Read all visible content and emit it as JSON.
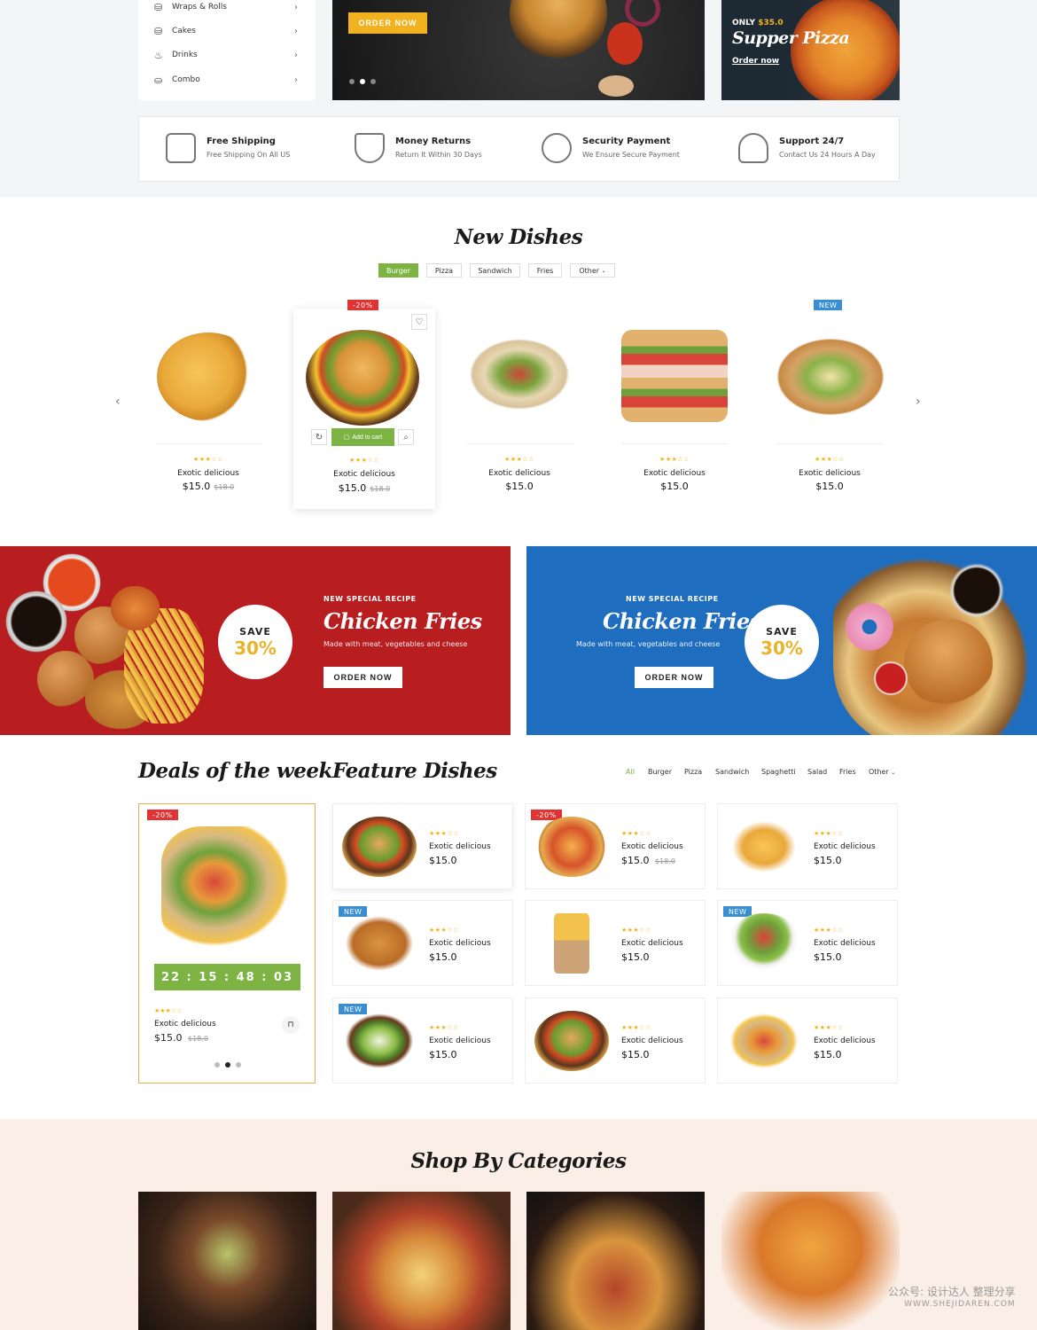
{
  "category_menu": [
    {
      "label": "Wraps & Rolls",
      "icon": "wrap-icon"
    },
    {
      "label": "Cakes",
      "icon": "cake-icon"
    },
    {
      "label": "Drinks",
      "icon": "drink-icon"
    },
    {
      "label": "Combo",
      "icon": "combo-icon"
    }
  ],
  "hero": {
    "order_label": "ORDER NOW"
  },
  "promo": {
    "only": "ONLY",
    "price": "$35.0",
    "title": "Supper Pizza",
    "link": "Order now"
  },
  "features": [
    {
      "title": "Free Shipping",
      "sub": "Free Shipping On All US",
      "icon": "scooter-icon"
    },
    {
      "title": "Money Returns",
      "sub": "Return It Within 30 Days",
      "icon": "shield-check-icon"
    },
    {
      "title": "Security Payment",
      "sub": "We Ensure Secure Payment",
      "icon": "hand-coin-icon"
    },
    {
      "title": "Support 24/7",
      "sub": "Contact Us 24 Hours A Day",
      "icon": "headset-icon"
    }
  ],
  "new_dishes": {
    "title": "New Dishes",
    "tabs": [
      "Burger",
      "Pizza",
      "Sandwich",
      "Fries",
      "Other"
    ],
    "products": [
      {
        "name": "Exotic delicious",
        "price": "$15.0",
        "old": "$18.0"
      },
      {
        "name": "Exotic delicious",
        "price": "$15.0",
        "old": "$18.0",
        "badge": "-20%",
        "cart": "Add to cart"
      },
      {
        "name": "Exotic delicious",
        "price": "$15.0"
      },
      {
        "name": "Exotic delicious",
        "price": "$15.0"
      },
      {
        "name": "Exotic delicious",
        "price": "$15.0",
        "badge": "NEW"
      }
    ]
  },
  "banners": [
    {
      "sub": "NEW SPECIAL RECIPE",
      "title": "Chicken Fries",
      "desc": "Made with meat, vegetables and cheese",
      "btn": "ORDER NOW",
      "save": "SAVE",
      "pct": "30%"
    },
    {
      "sub": "NEW SPECIAL RECIPE",
      "title": "Chicken Fries",
      "desc": "Made with meat, vegetables and cheese",
      "btn": "ORDER NOW",
      "save": "SAVE",
      "pct": "30%"
    }
  ],
  "deals": {
    "title": "Deals of the week",
    "badge": "-20%",
    "timer": "22 : 15 : 48 : 03",
    "name": "Exotic delicious",
    "price": "$15.0",
    "old": "$18.0"
  },
  "feature_dishes": {
    "title": "Feature Dishes",
    "filters": [
      "All",
      "Burger",
      "Pizza",
      "Sandwich",
      "Spaghetti",
      "Salad",
      "Fries",
      "Other"
    ],
    "items": [
      {
        "name": "Exotic delicious",
        "price": "$15.0"
      },
      {
        "name": "Exotic delicious",
        "price": "$15.0",
        "old": "$18.0",
        "badge": "-20%"
      },
      {
        "name": "Exotic delicious",
        "price": "$15.0"
      },
      {
        "name": "Exotic delicious",
        "price": "$15.0",
        "badge": "NEW"
      },
      {
        "name": "Exotic delicious",
        "price": "$15.0"
      },
      {
        "name": "Exotic delicious",
        "price": "$15.0",
        "badge": "NEW"
      },
      {
        "name": "Exotic delicious",
        "price": "$15.0",
        "badge": "NEW"
      },
      {
        "name": "Exotic delicious",
        "price": "$15.0"
      },
      {
        "name": "Exotic delicious",
        "price": "$15.0"
      }
    ]
  },
  "shop_by": {
    "title": "Shop By Categories"
  },
  "watermark": {
    "line1": "公众号: 设计达人 整理分享",
    "line2": "WWW.SHEJIDAREN.COM"
  },
  "icons": {
    "stars": "★★★☆☆",
    "chevron": "›",
    "prev": "‹",
    "next": "›",
    "heart": "♡",
    "search": "⌕",
    "refresh": "↻",
    "cart": "🛒"
  },
  "colors": {
    "accent_green": "#7cb342",
    "accent_yellow": "#f0b21f",
    "red_banner": "#b81d20",
    "blue_banner": "#1f6dbf",
    "sale_red": "#e03333",
    "new_blue": "#3a8ed0"
  }
}
